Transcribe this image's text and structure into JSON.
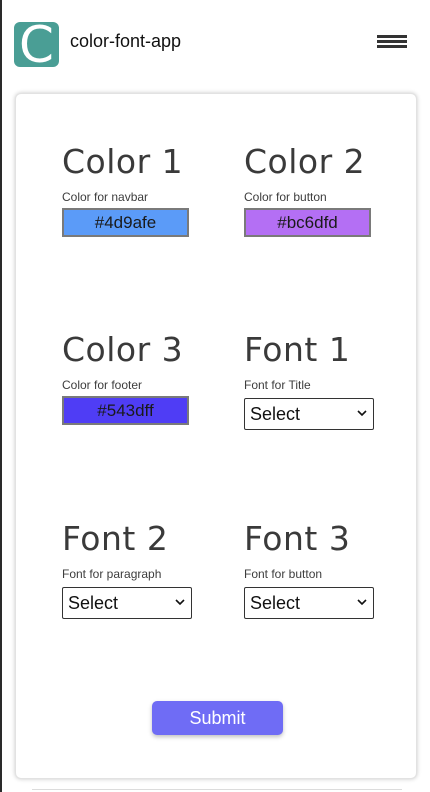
{
  "navbar": {
    "logo_letter": "C",
    "title": "color-font-app"
  },
  "colors": [
    {
      "heading": "Color 1",
      "description": "Color for navbar",
      "value": "#4d9afe",
      "swatch": "#5b9bf8"
    },
    {
      "heading": "Color 2",
      "description": "Color for button",
      "value": "#bc6dfd",
      "swatch": "#b46ff4"
    },
    {
      "heading": "Color 3",
      "description": "Color for footer",
      "value": "#543dff",
      "swatch": "#4f3df5"
    }
  ],
  "fonts": [
    {
      "heading": "Font 1",
      "description": "Font for Title",
      "selected": "Select"
    },
    {
      "heading": "Font 2",
      "description": "Font for paragraph",
      "selected": "Select"
    },
    {
      "heading": "Font 3",
      "description": "Font for button",
      "selected": "Select"
    }
  ],
  "submit_label": "Submit",
  "theme": {
    "logo_bg": "#4a9e95",
    "submit_bg": "#6f6cf5"
  }
}
